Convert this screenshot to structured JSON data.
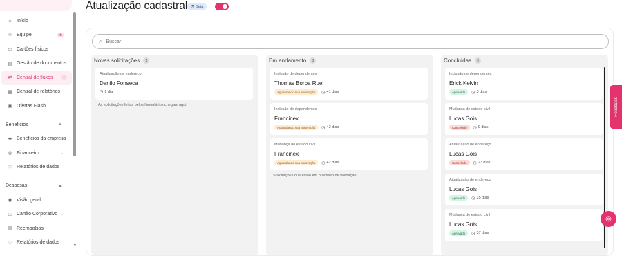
{
  "sidebar": {
    "items": [
      {
        "label": "Início",
        "icon": "home-icon"
      },
      {
        "label": "Equipe",
        "icon": "users-icon",
        "badge": "+"
      },
      {
        "label": "Cartões físicos",
        "icon": "card-icon"
      },
      {
        "label": "Gestão de documentos",
        "icon": "folder-icon"
      },
      {
        "label": "Central de fluxos",
        "icon": "flow-icon",
        "badge": "+"
      },
      {
        "label": "Central de relatórios",
        "icon": "report-icon"
      },
      {
        "label": "Ofertas Flash",
        "icon": "offer-icon"
      }
    ],
    "sections": [
      {
        "title": "Benefícios",
        "items": [
          {
            "label": "Benefícios da empresa",
            "icon": "gift-icon"
          },
          {
            "label": "Financeiro",
            "icon": "money-icon"
          },
          {
            "label": "Relatórios de dados",
            "icon": "chart-icon"
          }
        ]
      },
      {
        "title": "Despesas",
        "items": [
          {
            "label": "Visão geral",
            "icon": "eye-icon"
          },
          {
            "label": "Cartão Corporativo",
            "icon": "card-icon"
          },
          {
            "label": "Reembolsos",
            "icon": "refund-icon"
          },
          {
            "label": "Relatórios de dados",
            "icon": "chart-icon"
          }
        ]
      }
    ]
  },
  "header": {
    "title": "Atualização cadastral",
    "beta": "Beta"
  },
  "search": {
    "placeholder": "Buscar"
  },
  "columns": [
    {
      "title": "Novas solicitações",
      "count": "1",
      "cards": [
        {
          "type": "Atualização de endereço",
          "name": "Danilo Fonseca",
          "time": "1 dia"
        }
      ],
      "hint": "As solicitações feitas pelos formulários chegam aqui."
    },
    {
      "title": "Em andamento",
      "count": "3",
      "cards": [
        {
          "type": "Inclusão de dependentes",
          "name": "Thomas Borba Ruel",
          "status": "Aguardando sua aprovação",
          "time": "41 dias"
        },
        {
          "type": "Inclusão de dependentes",
          "name": "Francinex",
          "status": "Aguardando sua aprovação",
          "time": "42 dias"
        },
        {
          "type": "Mudança de estado civil",
          "name": "Francinex",
          "status": "Aguardando sua aprovação",
          "time": "42 dias"
        }
      ],
      "hint": "Solicitações que estão em processo de validação."
    },
    {
      "title": "Concluídas",
      "count": "9",
      "cards": [
        {
          "type": "Inclusão de dependentes",
          "name": "Erick Kelvin",
          "status": "Aprovado",
          "time": "3 dias"
        },
        {
          "type": "Mudança de estado civil",
          "name": "Lucas Gois",
          "status": "Cancelado",
          "time": "9 dias"
        },
        {
          "type": "Atualização de endereço",
          "name": "Lucas Gois",
          "status": "Cancelado",
          "time": "23 dias"
        },
        {
          "type": "Atualização de endereço",
          "name": "Lucas Gois",
          "status": "Aprovado",
          "time": "35 dias"
        },
        {
          "type": "Mudança de estado civil",
          "name": "Lucas Gois",
          "status": "Aprovado",
          "time": "37 dias"
        }
      ]
    }
  ],
  "feedback": "Feedback",
  "colors": {
    "accent": "#e4336c"
  }
}
